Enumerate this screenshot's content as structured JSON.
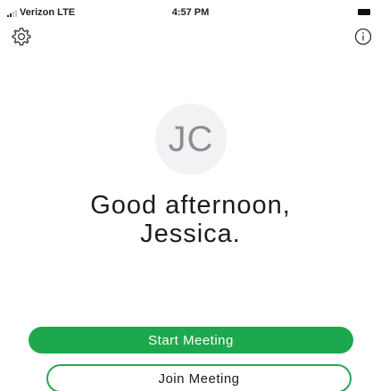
{
  "status_bar": {
    "carrier": "Verizon  LTE",
    "time": "4:57 PM"
  },
  "header": {
    "settings_icon": "gear-icon",
    "info_icon": "info-icon"
  },
  "profile": {
    "initials": "JC",
    "greeting_line1": "Good afternoon,",
    "greeting_line2": "Jessica."
  },
  "actions": {
    "start_label": "Start Meeting",
    "join_label": "Join Meeting"
  },
  "colors": {
    "accent": "#1ea84d",
    "avatar_bg": "#f1f2f4"
  }
}
